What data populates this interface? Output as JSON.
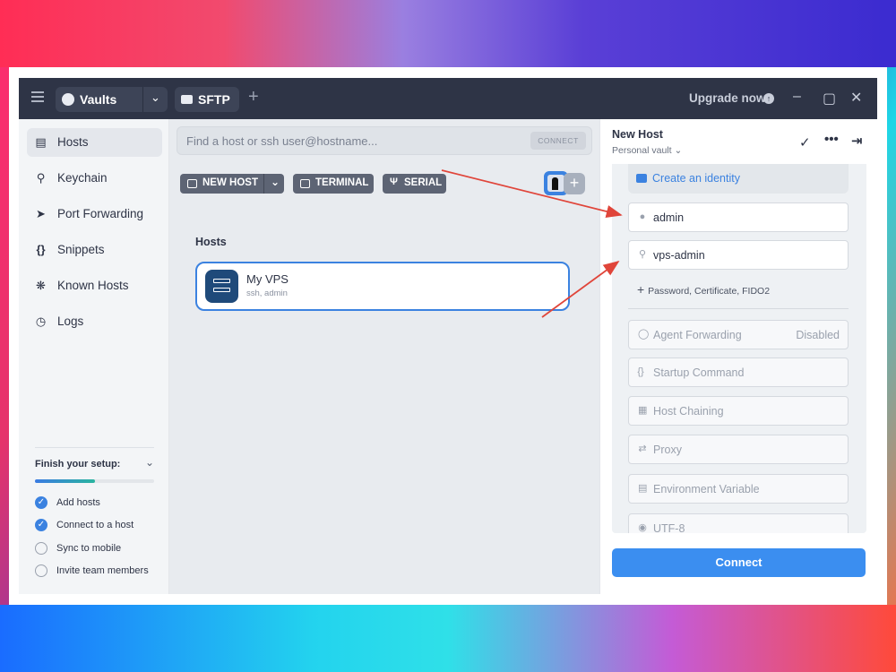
{
  "titlebar": {
    "vault_label": "Vaults",
    "sftp_label": "SFTP",
    "upgrade_label": "Upgrade now",
    "icons": [
      "menu-icon",
      "vault-icon",
      "chevron-down-icon",
      "folder-icon",
      "plus-icon",
      "info-icon",
      "minimize-icon",
      "maximize-icon",
      "close-icon"
    ]
  },
  "sidebar": {
    "items": [
      {
        "label": "Hosts",
        "icon": "server-icon",
        "active": true
      },
      {
        "label": "Keychain",
        "icon": "key-icon"
      },
      {
        "label": "Port Forwarding",
        "icon": "arrow-icon"
      },
      {
        "label": "Snippets",
        "icon": "braces-icon"
      },
      {
        "label": "Known Hosts",
        "icon": "fingerprint-icon"
      },
      {
        "label": "Logs",
        "icon": "clock-icon"
      }
    ],
    "setup": {
      "title": "Finish your setup:",
      "progress": 0.5,
      "tasks": [
        {
          "label": "Add hosts",
          "done": true
        },
        {
          "label": "Connect to a host",
          "done": true
        },
        {
          "label": "Sync to mobile",
          "done": false
        },
        {
          "label": "Invite team members",
          "done": false
        }
      ]
    }
  },
  "main": {
    "search_placeholder": "Find a host or ssh user@hostname...",
    "search_connect": "CONNECT",
    "toolbar": {
      "new_host": "NEW HOST",
      "terminal": "TERMINAL",
      "serial": "SERIAL"
    },
    "hosts_heading": "Hosts",
    "host": {
      "name": "My VPS",
      "sub": "ssh, admin"
    }
  },
  "panel": {
    "title": "New Host",
    "subtitle": "Personal vault",
    "create_identity": "Create an identity",
    "username": "admin",
    "password": "vps-admin",
    "add_credentials": "Password, Certificate, FIDO2",
    "agent_forwarding": "Agent Forwarding",
    "agent_forwarding_value": "Disabled",
    "startup_command": "Startup Command",
    "host_chaining": "Host Chaining",
    "proxy": "Proxy",
    "env_var": "Environment Variable",
    "charset": "UTF-8",
    "connect": "Connect"
  },
  "colors": {
    "accent": "#3b8ef0",
    "titlebar": "#2e3446",
    "annotation_arrow": "#e0453a"
  }
}
